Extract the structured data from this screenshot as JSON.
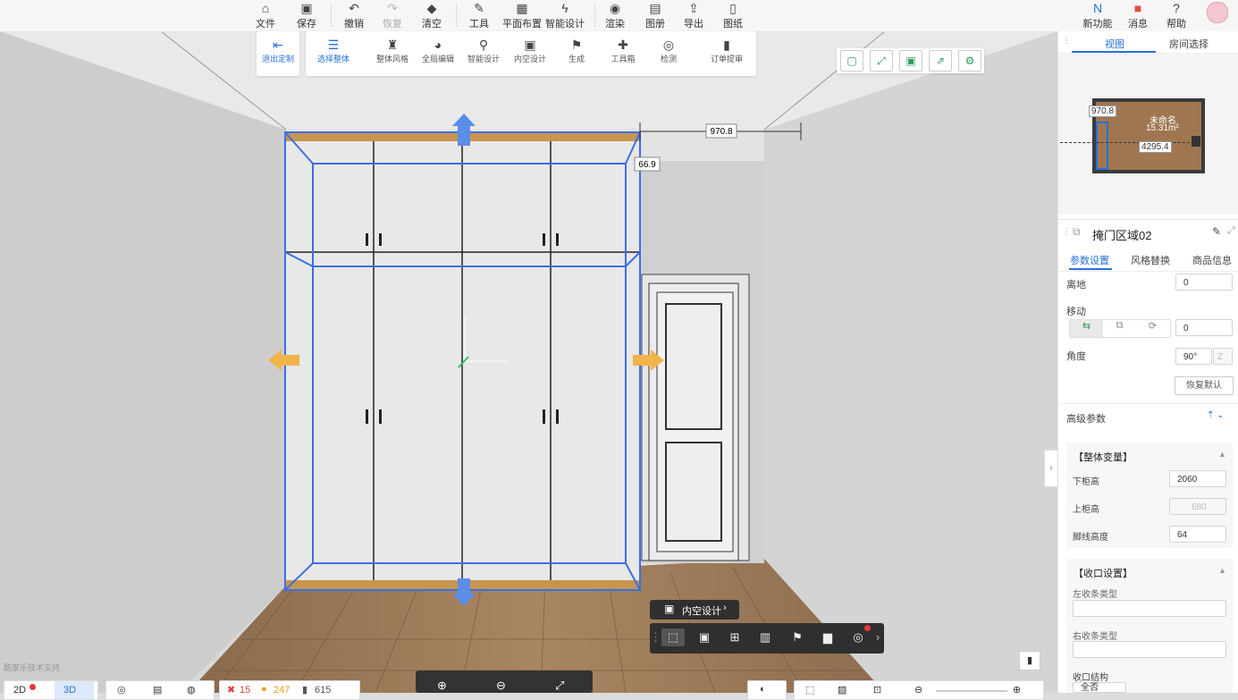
{
  "topbar": {
    "items": [
      {
        "label": "文件",
        "icon": "house-icon"
      },
      {
        "label": "保存",
        "icon": "save-icon"
      },
      {
        "label": "撤销",
        "icon": "undo-icon"
      },
      {
        "label": "恢复",
        "icon": "redo-icon"
      },
      {
        "label": "清空",
        "icon": "eraser-icon"
      },
      {
        "label": "工具",
        "icon": "wrench-icon"
      },
      {
        "label": "平面布置",
        "icon": "layout-icon"
      },
      {
        "label": "智能设计",
        "icon": "bolt-icon"
      },
      {
        "label": "渲染",
        "icon": "render-icon"
      },
      {
        "label": "图册",
        "icon": "album-icon"
      },
      {
        "label": "导出",
        "icon": "export-icon"
      },
      {
        "label": "图纸",
        "icon": "drawing-icon"
      }
    ],
    "right_items": [
      {
        "label": "新功能",
        "icon": "new-feature-icon"
      },
      {
        "label": "消息",
        "icon": "gift-icon"
      },
      {
        "label": "帮助",
        "icon": "help-icon"
      }
    ]
  },
  "toolbar2": {
    "exit_label": "退出定制",
    "items": [
      {
        "label": "选择整体"
      },
      {
        "label": "整体风格"
      },
      {
        "label": "全局编辑"
      },
      {
        "label": "智能设计"
      },
      {
        "label": "内空设计"
      },
      {
        "label": "生成"
      },
      {
        "label": "工具箱"
      },
      {
        "label": "检测"
      },
      {
        "label": "订单提审"
      }
    ]
  },
  "viewport": {
    "dim_top": "970.8",
    "dim_side": "66.9"
  },
  "right_panel": {
    "tabs": [
      {
        "label": "视图"
      },
      {
        "label": "房间选择"
      }
    ],
    "minimap": {
      "room_name": "未命名",
      "room_area": "15.31m²",
      "dim_a": "970.8",
      "dim_b": "4295.4"
    },
    "props_title": "掩门区域02",
    "prop_tabs": [
      {
        "label": "参数设置"
      },
      {
        "label": "风格替换"
      },
      {
        "label": "商品信息"
      }
    ],
    "fields": {
      "ground_label": "离地",
      "ground_value": "0",
      "move_label": "移动",
      "move_value": "0",
      "angle_label": "角度",
      "angle_value": "90°",
      "angle_axis": "Z",
      "reset_label": "恢复默认",
      "advanced_label": "高级参数",
      "section1": "【整体变量】",
      "lower_label": "下柜高",
      "lower_value": "2060",
      "upper_label": "上柜高",
      "upper_value": "680",
      "baseboard_label": "脚线高度",
      "baseboard_value": "64",
      "section2": "【收口设置】",
      "left_label": "左收条类型",
      "right_label": "右收条类型",
      "struct_label": "收口结构",
      "struct_value": "全否"
    }
  },
  "context_bar": {
    "title": "内空设计"
  },
  "bottom": {
    "view_2d": "2D",
    "view_3d": "3D",
    "errors": "15",
    "warnings": "247",
    "count": "615",
    "support": "酷家乐技术支持"
  },
  "colors": {
    "accent": "#2472d9",
    "selection": "#3b6fe6",
    "handle": "#f0b44a",
    "wood": "#c8954f"
  }
}
